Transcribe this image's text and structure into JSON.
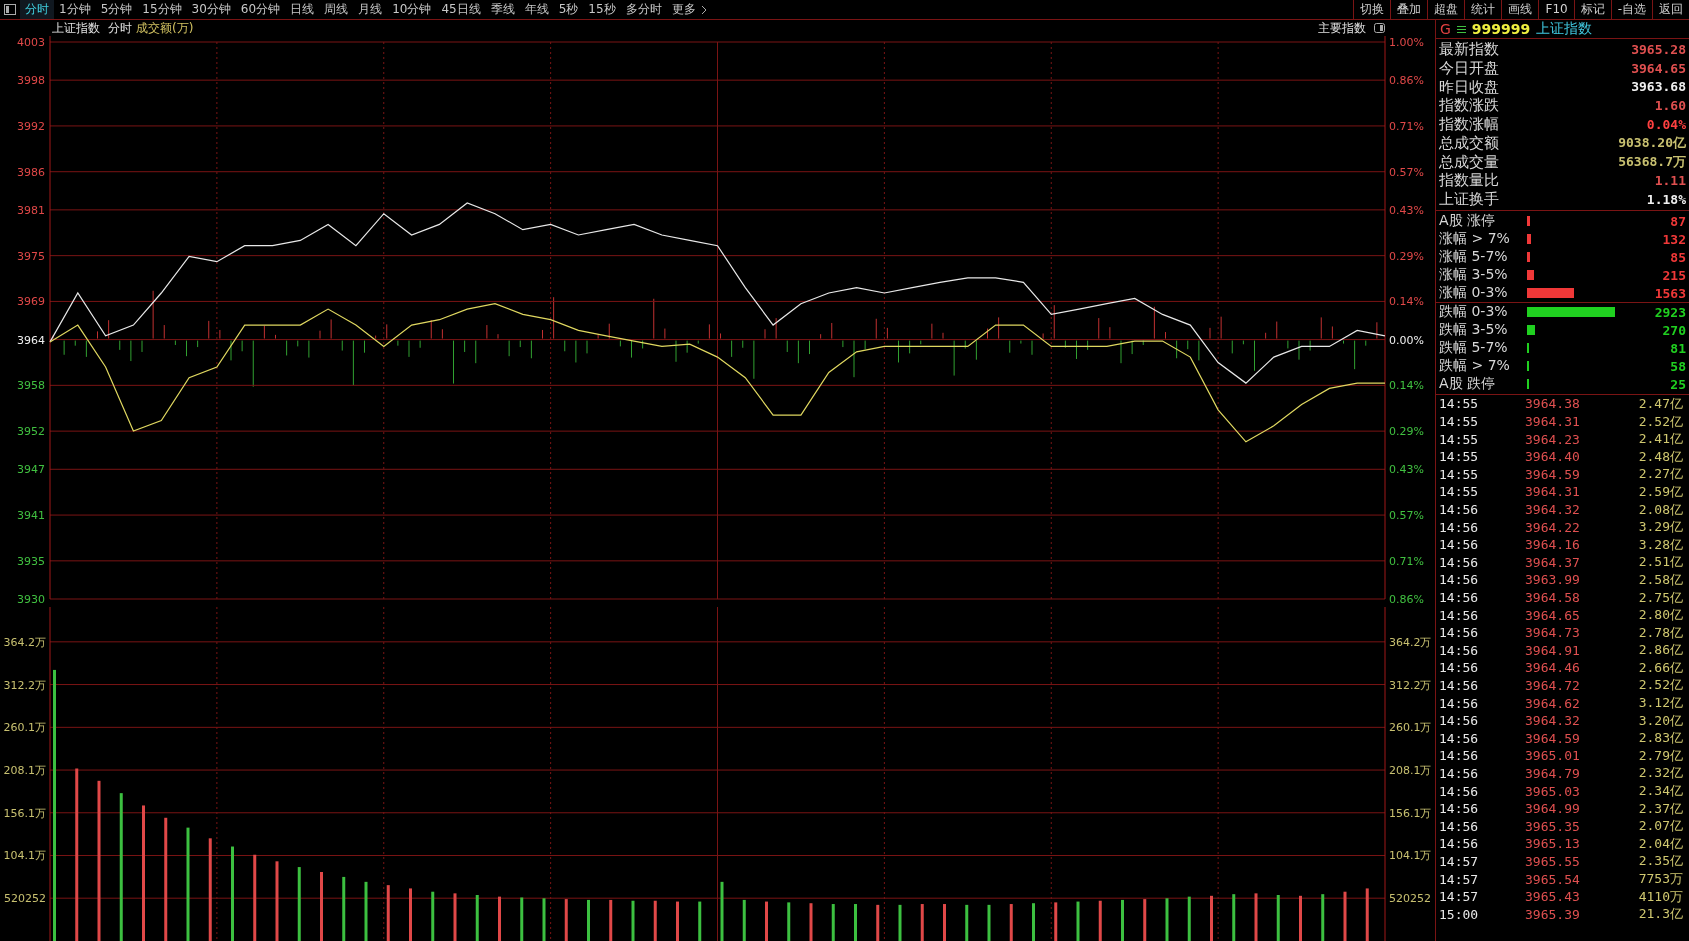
{
  "toolbar": {
    "tabs": [
      {
        "label": "分时",
        "selected": true
      },
      {
        "label": "1分钟",
        "selected": false
      },
      {
        "label": "5分钟",
        "selected": false
      },
      {
        "label": "15分钟",
        "selected": false
      },
      {
        "label": "30分钟",
        "selected": false
      },
      {
        "label": "60分钟",
        "selected": false
      },
      {
        "label": "日线",
        "selected": false
      },
      {
        "label": "周线",
        "selected": false
      },
      {
        "label": "月线",
        "selected": false
      },
      {
        "label": "10分钟",
        "selected": false
      },
      {
        "label": "45日线",
        "selected": false
      },
      {
        "label": "季线",
        "selected": false
      },
      {
        "label": "年线",
        "selected": false
      },
      {
        "label": "5秒",
        "selected": false
      },
      {
        "label": "15秒",
        "selected": false
      },
      {
        "label": "多分时",
        "selected": false
      }
    ],
    "more": "更多",
    "actions": [
      "切换",
      "叠加",
      "超盘",
      "统计",
      "画线",
      "F10",
      "标记",
      "-自选",
      "返回"
    ]
  },
  "chart_header": {
    "title": "上证指数",
    "mode": "分时",
    "indicator": "成交额(万)",
    "index_selector": "主要指数"
  },
  "price_chart": {
    "chart_data": {
      "type": "line",
      "grid": true,
      "ylim": [
        3930,
        4003
      ],
      "yticks": [
        4003,
        3998,
        3992,
        3986,
        3981,
        3975,
        3969,
        3964,
        3958,
        3952,
        3947,
        3941,
        3935,
        3930
      ],
      "series": [
        {
          "color": "#e8e8e8",
          "values": [
            3963.7,
            3970.1,
            3964.5,
            3965.9,
            3970.1,
            3974.9,
            3974.2,
            3976.3,
            3976.3,
            3977.0,
            3979.1,
            3976.3,
            3980.5,
            3977.7,
            3979.1,
            3981.9,
            3980.5,
            3978.4,
            3979.1,
            3977.7,
            3978.4,
            3979.1,
            3977.7,
            3977.0,
            3976.3,
            3970.8,
            3965.9,
            3968.7,
            3970.1,
            3970.8,
            3970.1,
            3970.8,
            3971.5,
            3972.1,
            3972.1,
            3971.5,
            3967.3,
            3968.0,
            3968.7,
            3969.4,
            3967.3,
            3965.9,
            3961.0,
            3958.3,
            3961.7,
            3963.1,
            3963.1,
            3965.2,
            3964.5
          ]
        },
        {
          "color": "#e0d860",
          "values": [
            3963.7,
            3965.9,
            3960.4,
            3952.0,
            3953.4,
            3959.0,
            3960.4,
            3965.9,
            3965.9,
            3965.9,
            3968.0,
            3965.9,
            3963.1,
            3965.9,
            3966.6,
            3968.0,
            3968.7,
            3967.3,
            3966.6,
            3965.2,
            3964.5,
            3963.8,
            3963.1,
            3963.4,
            3961.7,
            3959.0,
            3954.1,
            3954.1,
            3959.7,
            3962.4,
            3963.1,
            3963.1,
            3963.1,
            3963.1,
            3965.9,
            3965.9,
            3963.1,
            3963.1,
            3963.1,
            3963.8,
            3963.8,
            3961.7,
            3954.8,
            3950.6,
            3952.7,
            3955.5,
            3957.6,
            3958.3,
            3958.3
          ]
        }
      ]
    },
    "right_axis_labels": [
      "1.00%",
      "0.86%",
      "0.71%",
      "0.57%",
      "0.43%",
      "0.29%",
      "0.14%",
      "0.00%",
      "0.14%",
      "0.29%",
      "0.43%",
      "0.57%",
      "0.71%",
      "0.86%"
    ]
  },
  "volume_chart": {
    "chart_data": {
      "type": "bar",
      "grid": true,
      "ylim": [
        0,
        406.6
      ],
      "yticks": [
        {
          "value": 364.2,
          "label": "364.2万"
        },
        {
          "value": 312.2,
          "label": "312.2万"
        },
        {
          "value": 260.1,
          "label": "260.1万"
        },
        {
          "value": 208.1,
          "label": "208.1万"
        },
        {
          "value": 156.1,
          "label": "156.1万"
        },
        {
          "value": 104.1,
          "label": "104.1万"
        }
      ],
      "series": [
        {
          "color": "#e04848",
          "values": [
            null,
            210,
            195,
            null,
            165,
            150,
            null,
            125,
            null,
            105,
            97,
            null,
            84,
            null,
            null,
            68,
            64,
            null,
            58,
            null,
            54,
            null,
            null,
            51,
            null,
            50,
            null,
            49,
            48,
            null,
            null,
            null,
            48,
            null,
            46,
            null,
            null,
            44,
            null,
            45,
            45,
            null,
            null,
            45,
            null,
            47,
            null,
            49,
            null,
            51,
            null,
            null,
            55,
            null,
            58,
            null,
            55,
            null,
            60,
            64
          ]
        },
        {
          "color": "#3cc040",
          "values": [
            330,
            null,
            null,
            180,
            null,
            null,
            138,
            null,
            115,
            null,
            null,
            90,
            null,
            78,
            72,
            null,
            null,
            60,
            null,
            56,
            null,
            53,
            52,
            null,
            50,
            null,
            49,
            null,
            null,
            48,
            72,
            50,
            null,
            47,
            null,
            45,
            45,
            null,
            44,
            null,
            null,
            44,
            44,
            null,
            46,
            null,
            48,
            null,
            50,
            null,
            52,
            54,
            null,
            57,
            null,
            56,
            null,
            57,
            null,
            null
          ]
        }
      ]
    },
    "bottom_label": "520252",
    "right_axis_labels": [
      "364.2万",
      "312.2万",
      "260.1万",
      "208.1万",
      "156.1万",
      "104.1万",
      "520252"
    ]
  },
  "quote_panel": {
    "market_flag": "G",
    "code": "999999",
    "name": "上证指数",
    "stats": [
      {
        "label": "最新指数",
        "value": "3965.28",
        "color": "#e05050"
      },
      {
        "label": "今日开盘",
        "value": "3964.65",
        "color": "#e05050"
      },
      {
        "label": "昨日收盘",
        "value": "3963.68",
        "color": "#f0f0f0"
      },
      {
        "label": "指数涨跌",
        "value": "1.60",
        "color": "#e05050"
      },
      {
        "label": "指数涨幅",
        "value": "0.04%",
        "color": "#ff4040"
      },
      {
        "label": "总成交额",
        "value": "9038.20亿",
        "color": "#c8c070"
      },
      {
        "label": "总成交量",
        "value": "56368.7万",
        "color": "#c8c070"
      },
      {
        "label": "指数量比",
        "value": "1.11",
        "color": "#e05050"
      },
      {
        "label": "上证换手",
        "value": "1.18%",
        "color": "#f0f0f0"
      }
    ],
    "breadth": [
      {
        "label": "A股 涨停",
        "count": "87",
        "color": "#f03838"
      },
      {
        "label": "涨幅 > 7%",
        "count": "132",
        "color": "#f03838"
      },
      {
        "label": "涨幅 5-7%",
        "count": "85",
        "color": "#f03838"
      },
      {
        "label": "涨幅 3-5%",
        "count": "215",
        "color": "#f03838"
      },
      {
        "label": "涨幅 0-3%",
        "count": "1563",
        "color": "#f03838"
      },
      {
        "label": "跌幅 0-3%",
        "count": "2923",
        "color": "#20d020"
      },
      {
        "label": "跌幅 3-5%",
        "count": "270",
        "color": "#20d020"
      },
      {
        "label": "跌幅 5-7%",
        "count": "81",
        "color": "#20d020"
      },
      {
        "label": "跌幅 > 7%",
        "count": "58",
        "color": "#20d020"
      },
      {
        "label": "A股 跌停",
        "count": "25",
        "color": "#20d020"
      }
    ],
    "ticks": [
      {
        "time": "14:55",
        "price": "3964.38",
        "amount": "2.47亿"
      },
      {
        "time": "14:55",
        "price": "3964.31",
        "amount": "2.52亿"
      },
      {
        "time": "14:55",
        "price": "3964.23",
        "amount": "2.41亿"
      },
      {
        "time": "14:55",
        "price": "3964.40",
        "amount": "2.48亿"
      },
      {
        "time": "14:55",
        "price": "3964.59",
        "amount": "2.27亿"
      },
      {
        "time": "14:55",
        "price": "3964.31",
        "amount": "2.59亿"
      },
      {
        "time": "14:56",
        "price": "3964.32",
        "amount": "2.08亿"
      },
      {
        "time": "14:56",
        "price": "3964.22",
        "amount": "3.29亿"
      },
      {
        "time": "14:56",
        "price": "3964.16",
        "amount": "3.28亿"
      },
      {
        "time": "14:56",
        "price": "3964.37",
        "amount": "2.51亿"
      },
      {
        "time": "14:56",
        "price": "3963.99",
        "amount": "2.58亿"
      },
      {
        "time": "14:56",
        "price": "3964.58",
        "amount": "2.75亿"
      },
      {
        "time": "14:56",
        "price": "3964.65",
        "amount": "2.80亿"
      },
      {
        "time": "14:56",
        "price": "3964.73",
        "amount": "2.78亿"
      },
      {
        "time": "14:56",
        "price": "3964.91",
        "amount": "2.86亿"
      },
      {
        "time": "14:56",
        "price": "3964.46",
        "amount": "2.66亿"
      },
      {
        "time": "14:56",
        "price": "3964.72",
        "amount": "2.52亿"
      },
      {
        "time": "14:56",
        "price": "3964.62",
        "amount": "3.12亿"
      },
      {
        "time": "14:56",
        "price": "3964.32",
        "amount": "3.20亿"
      },
      {
        "time": "14:56",
        "price": "3964.59",
        "amount": "2.83亿"
      },
      {
        "time": "14:56",
        "price": "3965.01",
        "amount": "2.79亿"
      },
      {
        "time": "14:56",
        "price": "3964.79",
        "amount": "2.32亿"
      },
      {
        "time": "14:56",
        "price": "3965.03",
        "amount": "2.34亿"
      },
      {
        "time": "14:56",
        "price": "3964.99",
        "amount": "2.37亿"
      },
      {
        "time": "14:56",
        "price": "3965.35",
        "amount": "2.07亿"
      },
      {
        "time": "14:56",
        "price": "3965.13",
        "amount": "2.04亿"
      },
      {
        "time": "14:57",
        "price": "3965.55",
        "amount": "2.35亿"
      },
      {
        "time": "14:57",
        "price": "3965.54",
        "amount": "7753万"
      },
      {
        "time": "14:57",
        "price": "3965.43",
        "amount": "4110万"
      },
      {
        "time": "15:00",
        "price": "3965.39",
        "amount": "21.3亿"
      }
    ]
  }
}
